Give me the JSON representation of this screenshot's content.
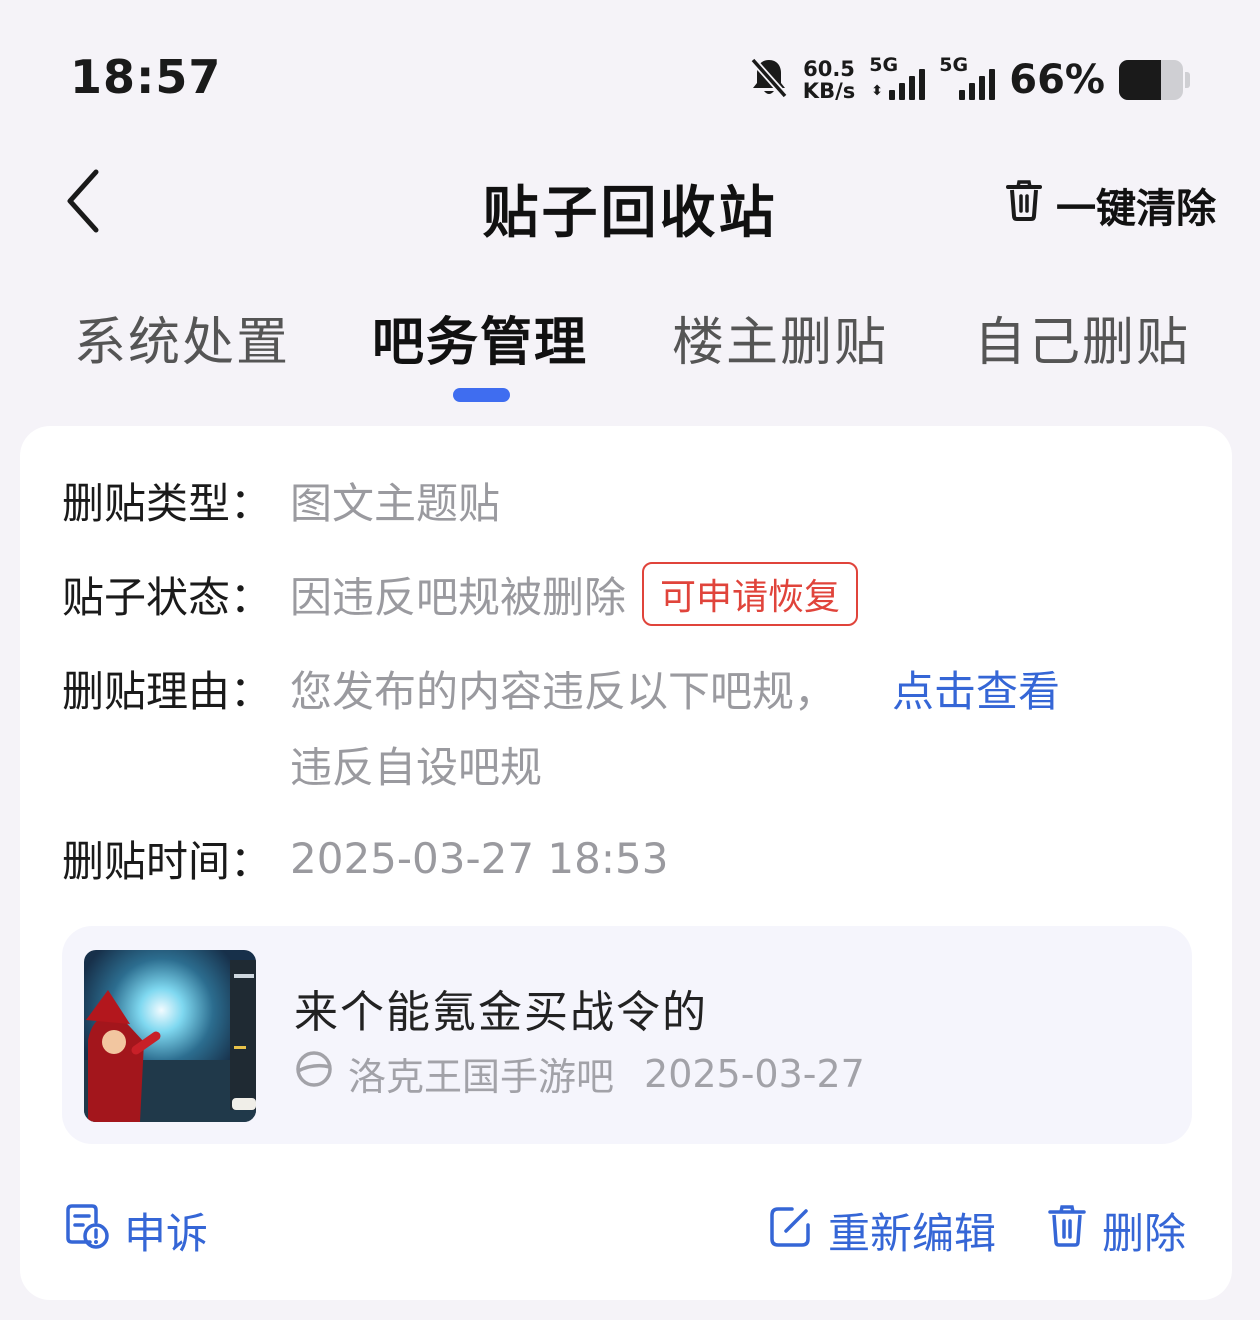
{
  "status_bar": {
    "time": "18:57",
    "net_speed_value": "60.5",
    "net_speed_unit": "KB/s",
    "sim1_tag": "5G",
    "sim2_tag": "5G",
    "battery_percent": "66%",
    "battery_level": 0.66
  },
  "header": {
    "title": "贴子回收站",
    "clear_all_label": "一键清除"
  },
  "tabs": [
    {
      "label": "系统处置",
      "active": false
    },
    {
      "label": "吧务管理",
      "active": true
    },
    {
      "label": "楼主删贴",
      "active": false
    },
    {
      "label": "自己删贴",
      "active": false
    }
  ],
  "card": {
    "type_label": "删贴类型：",
    "type_value": "图文主题贴",
    "status_label": "贴子状态：",
    "status_value": "因违反吧规被删除",
    "status_badge": "可申请恢复",
    "reason_label": "删贴理由：",
    "reason_value": "您发布的内容违反以下吧规，",
    "reason_link": "点击查看",
    "reason_detail": "违反自设吧规",
    "time_label": "删贴时间：",
    "time_value": "2025-03-27 18:53",
    "post": {
      "title": "来个能氪金买战令的",
      "forum": "洛克王国手游吧",
      "date": "2025-03-27"
    },
    "actions": {
      "appeal": "申诉",
      "reedit": "重新编辑",
      "delete": "删除"
    }
  },
  "colors": {
    "accent": "#3f6df0",
    "link": "#3566d6",
    "badge_red": "#e0443b",
    "background": "#f5f3f8"
  }
}
